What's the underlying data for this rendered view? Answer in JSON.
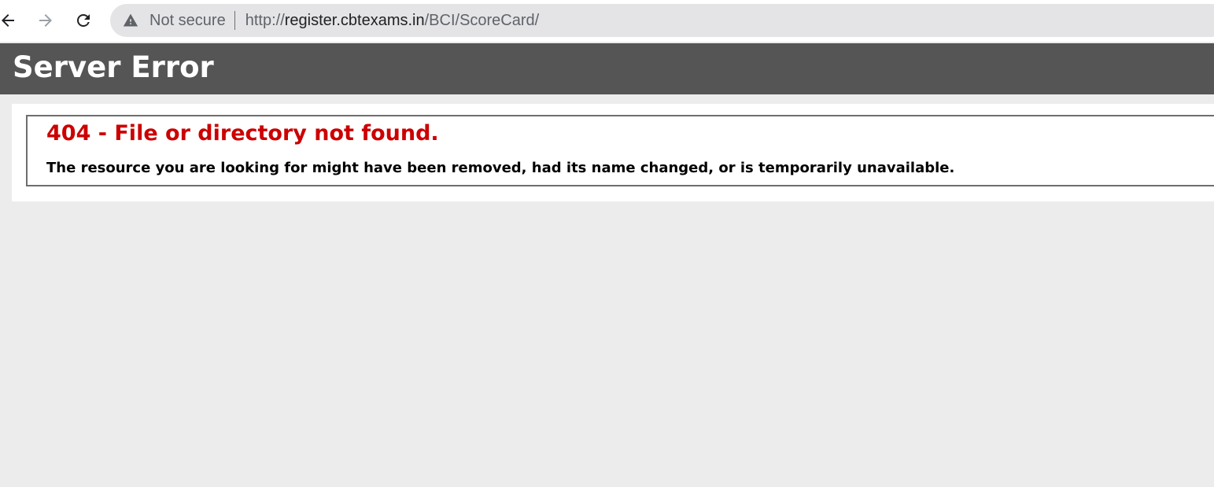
{
  "browser": {
    "security_label": "Not secure",
    "url_scheme": "http://",
    "url_host": "register.cbtexams.in",
    "url_path": "/BCI/ScoreCard/",
    "icons": {
      "back": "arrow-left-icon",
      "forward": "arrow-right-icon",
      "reload": "reload-icon",
      "security": "warning-triangle-icon"
    }
  },
  "page": {
    "title": "Server Error",
    "error_heading": "404 - File or directory not found.",
    "error_message": "The resource you are looking for might have been removed, had its name changed, or is temporarily unavailable."
  },
  "colors": {
    "header_bg": "#555555",
    "error_heading": "#cc0000",
    "page_bg": "#ececec",
    "omnibox_bg": "#e4e4e6"
  }
}
